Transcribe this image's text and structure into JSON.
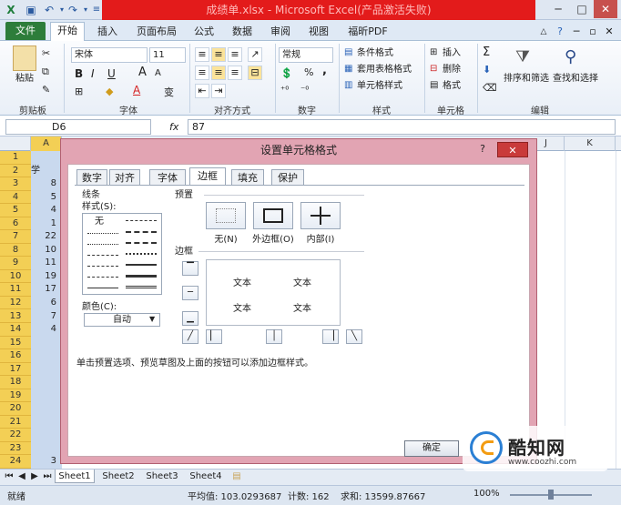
{
  "window": {
    "title": "成绩单.xlsx - Microsoft Excel(产品激活失败)",
    "controls": {
      "minimize": "─",
      "maximize": "□",
      "close": "✕"
    }
  },
  "ribbon_tabs": [
    "文件",
    "开始",
    "插入",
    "页面布局",
    "公式",
    "数据",
    "审阅",
    "视图",
    "福昕PDF"
  ],
  "ribbon": {
    "clipboard": {
      "paste": "粘贴",
      "label": "剪贴板"
    },
    "font": {
      "name": "宋体",
      "size": "11",
      "bold": "B",
      "italic": "I",
      "underline": "U",
      "grow": "A",
      "shrink": "A",
      "font_color": "A",
      "wen": "变",
      "label": "字体"
    },
    "alignment": {
      "label": "对齐方式"
    },
    "number": {
      "format": "常规",
      "percent": "%",
      "comma": ",",
      "label": "数字"
    },
    "styles": {
      "conditional": "条件格式",
      "table": "套用表格格式",
      "cell": "单元格样式",
      "label": "样式"
    },
    "cells": {
      "insert": "插入",
      "delete": "删除",
      "format": "格式",
      "label": "单元格"
    },
    "editing": {
      "sum": "Σ",
      "sort": "排序和筛选",
      "find": "查找和选择",
      "label": "编辑"
    }
  },
  "formula_bar": {
    "name_box": "D6",
    "fx": "fx",
    "value": "87"
  },
  "columns": [
    "A",
    "J",
    "K"
  ],
  "rows": [
    "1",
    "2",
    "3",
    "4",
    "5",
    "6",
    "7",
    "8",
    "9",
    "10",
    "11",
    "12",
    "13",
    "14",
    "15",
    "16",
    "17",
    "18",
    "19",
    "20",
    "21",
    "22",
    "23",
    "24"
  ],
  "colA_values": [
    "",
    "学",
    "8",
    "5",
    "4",
    "1",
    "22",
    "10",
    "11",
    "19",
    "17",
    "6",
    "7",
    "4",
    "",
    "",
    "",
    "",
    "",
    "",
    "",
    "",
    "",
    "3"
  ],
  "dialog": {
    "title": "设置单元格格式",
    "help": "?",
    "close": "✕",
    "tabs": [
      "数字",
      "对齐",
      "字体",
      "边框",
      "填充",
      "保护"
    ],
    "line_label": "线条",
    "style_label": "样式(S):",
    "style_none": "无",
    "color_label": "颜色(C):",
    "color_value": "自动",
    "presets_label": "预置",
    "presets": [
      "无(N)",
      "外边框(O)",
      "内部(I)"
    ],
    "border_label": "边框",
    "preview_text": [
      "文本",
      "文本",
      "文本",
      "文本"
    ],
    "hint": "单击预置选项、预览草图及上面的按钮可以添加边框样式。",
    "ok": "确定"
  },
  "sheets": [
    "Sheet1",
    "Sheet2",
    "Sheet3",
    "Sheet4"
  ],
  "status": {
    "ready": "就绪",
    "average": "平均值: 103.0293687",
    "count": "计数: 162",
    "sum": "求和: 13599.87667",
    "zoom": "100%"
  },
  "watermark": {
    "brand": "酷知网",
    "url": "www.coozhi.com"
  }
}
